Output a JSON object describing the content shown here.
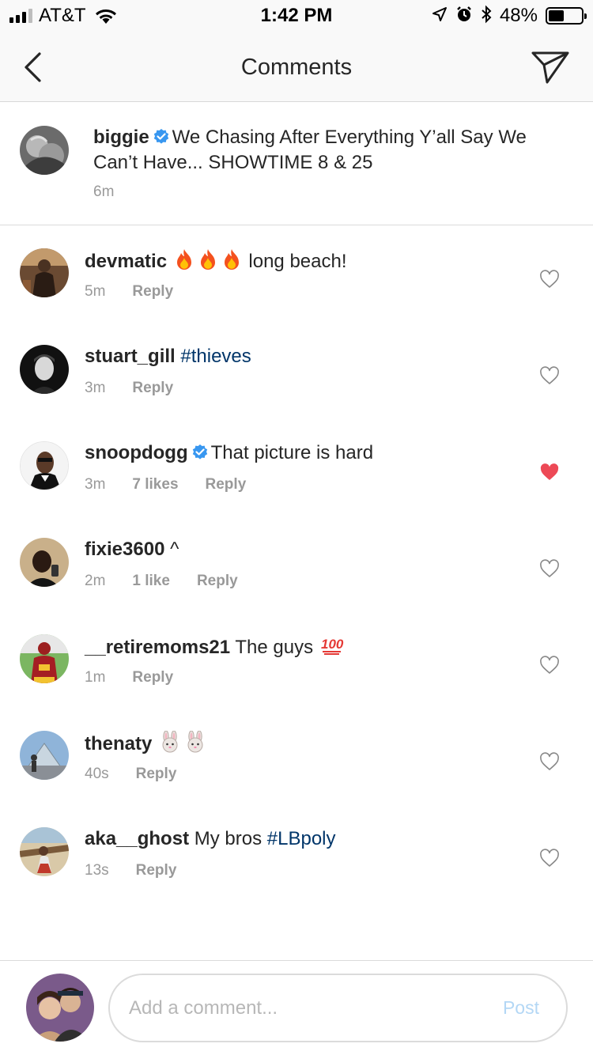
{
  "status_bar": {
    "carrier": "AT&T",
    "time": "1:42 PM",
    "battery_percent": "48%",
    "battery_level": 0.48
  },
  "nav": {
    "title": "Comments"
  },
  "caption": {
    "username": "biggie",
    "text": "We Chasing After Everything Y’all Say We Can’t Have... SHOWTIME 8 & 25",
    "time": "6m"
  },
  "comments": [
    {
      "username": "devmatic",
      "text_after": "long beach!",
      "time": "5m",
      "reply": "Reply"
    },
    {
      "username": "stuart_gill",
      "hashtag": "#thieves",
      "time": "3m",
      "reply": "Reply"
    },
    {
      "username": "snoopdogg",
      "text": "That picture is hard",
      "time": "3m",
      "likes": "7 likes",
      "reply": "Reply",
      "liked": true
    },
    {
      "username": "fixie3600",
      "text": "^",
      "time": "2m",
      "likes": "1 like",
      "reply": "Reply"
    },
    {
      "username": "__retiremoms21",
      "text": "The guys",
      "time": "1m",
      "reply": "Reply"
    },
    {
      "username": "thenaty",
      "time": "40s",
      "reply": "Reply"
    },
    {
      "username": "aka__ghost",
      "text": "My bros",
      "hashtag": "#LBpoly",
      "time": "13s",
      "reply": "Reply"
    }
  ],
  "composer": {
    "placeholder": "Add a comment...",
    "post_label": "Post"
  },
  "colors": {
    "hashtag": "#003569",
    "verified": "#3897f0",
    "liked_heart": "#ed4956",
    "meta_gray": "#999999",
    "post_disabled": "#b3d7f5"
  },
  "icons": {
    "back": "chevron-left-icon",
    "send": "paper-plane-icon",
    "heart": "heart-outline-icon",
    "heart_filled": "heart-filled-icon",
    "verified": "verified-badge-icon",
    "fire": "fire-emoji",
    "hundred": "hundred-points-emoji",
    "rabbit": "rabbit-face-emoji"
  }
}
